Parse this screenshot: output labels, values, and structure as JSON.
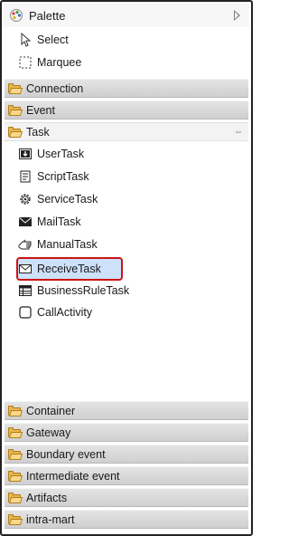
{
  "palette": {
    "title": "Palette",
    "tools": {
      "select": "Select",
      "marquee": "Marquee"
    },
    "drawers": {
      "connection": "Connection",
      "event": "Event",
      "task": "Task",
      "container": "Container",
      "gateway": "Gateway",
      "boundary_event": "Boundary event",
      "intermediate_event": "Intermediate event",
      "artifacts": "Artifacts",
      "intra_mart": "intra-mart"
    },
    "task_items": {
      "user_task": "UserTask",
      "script_task": "ScriptTask",
      "service_task": "ServiceTask",
      "mail_task": "MailTask",
      "manual_task": "ManualTask",
      "receive_task": "ReceiveTask",
      "business_rule_task": "BusinessRuleTask",
      "call_activity": "CallActivity"
    },
    "selected_item": "ReceiveTask",
    "colors": {
      "highlight": "#cde1fb",
      "annotation": "#cc1414",
      "folder": "#e8b64a"
    }
  }
}
